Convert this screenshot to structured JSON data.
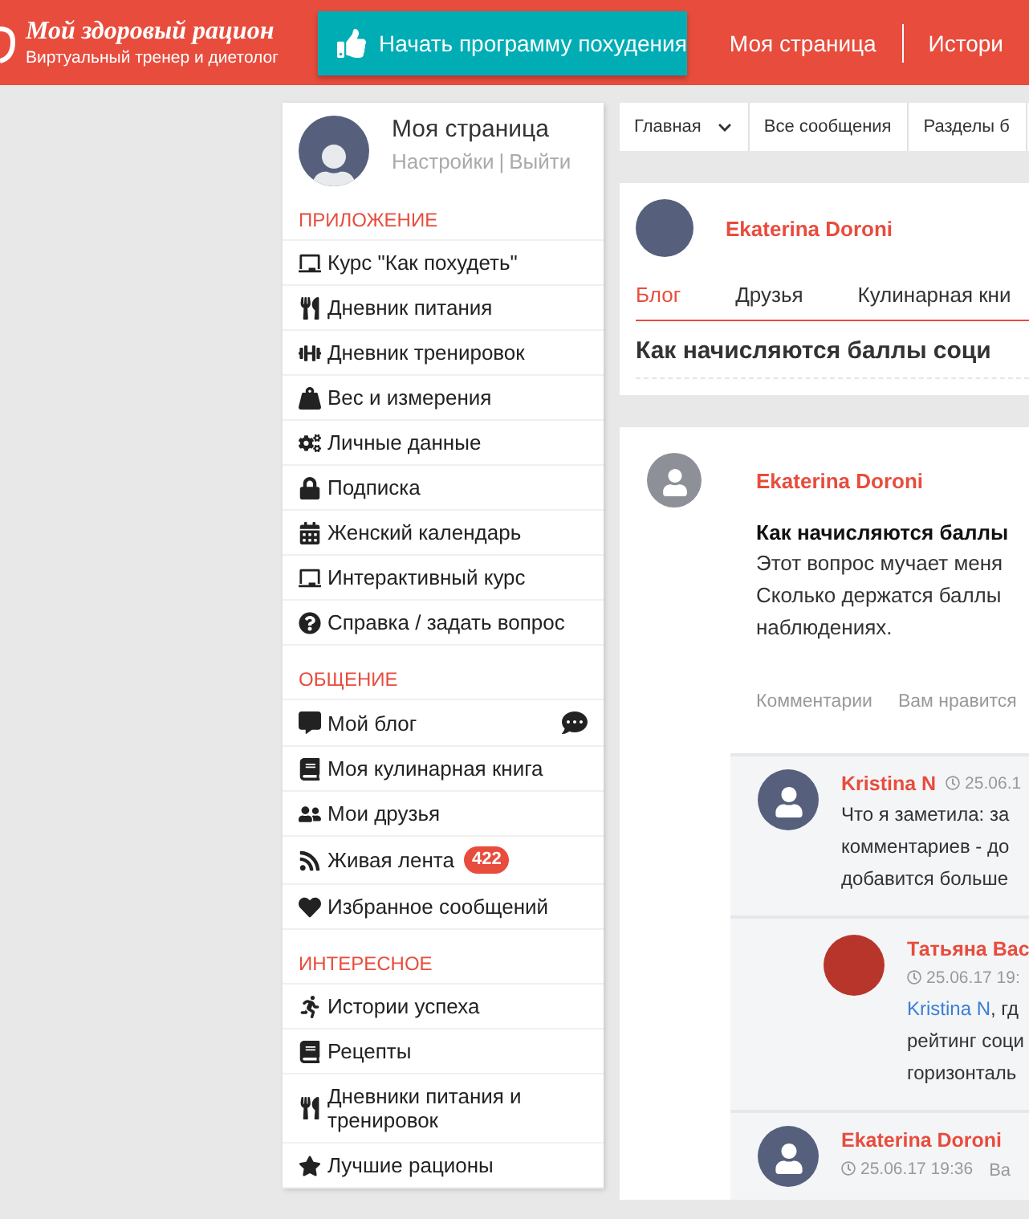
{
  "header": {
    "logo": {
      "title": "Мой здоровый рацион",
      "subtitle": "Виртуальный тренер и диетолог"
    },
    "cta_button": "Начать программу похудения",
    "nav": [
      "Моя страница",
      "Истори"
    ]
  },
  "sidebar": {
    "profile": {
      "name": "Моя страница",
      "links": [
        "Настройки",
        "Выйти"
      ],
      "separator": "|"
    },
    "sections": [
      {
        "title": "ПРИЛОЖЕНИЕ",
        "items": [
          {
            "label": "Курс \"Как похудеть\""
          },
          {
            "label": "Дневник питания"
          },
          {
            "label": "Дневник тренировок"
          },
          {
            "label": "Вес и измерения"
          },
          {
            "label": "Личные данные"
          },
          {
            "label": "Подписка"
          },
          {
            "label": "Женский календарь"
          },
          {
            "label": "Интерактивный курс"
          },
          {
            "label": "Справка / задать вопрос"
          }
        ]
      },
      {
        "title": "ОБЩЕНИЕ",
        "items": [
          {
            "label": "Мой блог"
          },
          {
            "label": "Моя кулинарная книга"
          },
          {
            "label": "Мои друзья"
          },
          {
            "label": "Живая лента",
            "badge": "422"
          },
          {
            "label": "Избранное сообщений"
          }
        ]
      },
      {
        "title": "ИНТЕРЕСНОЕ",
        "items": [
          {
            "label": "Истории успеха"
          },
          {
            "label": "Рецепты"
          },
          {
            "label": "Дневники питания и тренировок"
          },
          {
            "label": "Лучшие рационы"
          }
        ]
      }
    ]
  },
  "breadcrumbs": [
    {
      "label": "Главная",
      "dropdown": true
    },
    {
      "label": "Все сообщения",
      "dropdown": false
    },
    {
      "label": "Разделы б",
      "dropdown": false
    }
  ],
  "profile_card": {
    "author": "Ekaterina Doroni",
    "tabs": [
      {
        "label": "Блог",
        "selected": true
      },
      {
        "label": "Друзья",
        "selected": false
      },
      {
        "label": "Кулинарная кни",
        "selected": false
      }
    ],
    "title": "Как начисляются баллы соци"
  },
  "post": {
    "author": "Ekaterina Doroni",
    "title": "Как начисляются баллы",
    "body_lines": [
      "Этот вопрос мучает меня",
      "Сколько держатся баллы",
      "наблюдениях."
    ],
    "actions": [
      "Комментарии",
      "Вам нравится"
    ],
    "comments": [
      {
        "author": "Kristina N",
        "time": "25.06.1",
        "reply": false,
        "kind": "silhouette",
        "lines": [
          "Что я заметила: за",
          "комментариев - до",
          "добавится больше"
        ]
      },
      {
        "author": "Татьяна Вас",
        "time": "25.06.17 19:",
        "reply": true,
        "kind": "photo",
        "mention": "Kristina N",
        "lines": [
          ", гд",
          "рейтинг соци",
          "горизонталь"
        ]
      },
      {
        "author": "Ekaterina Doroni",
        "time": "25.06.17 19:36",
        "reply": false,
        "kind": "silhouette",
        "extra": "Ва"
      }
    ]
  }
}
